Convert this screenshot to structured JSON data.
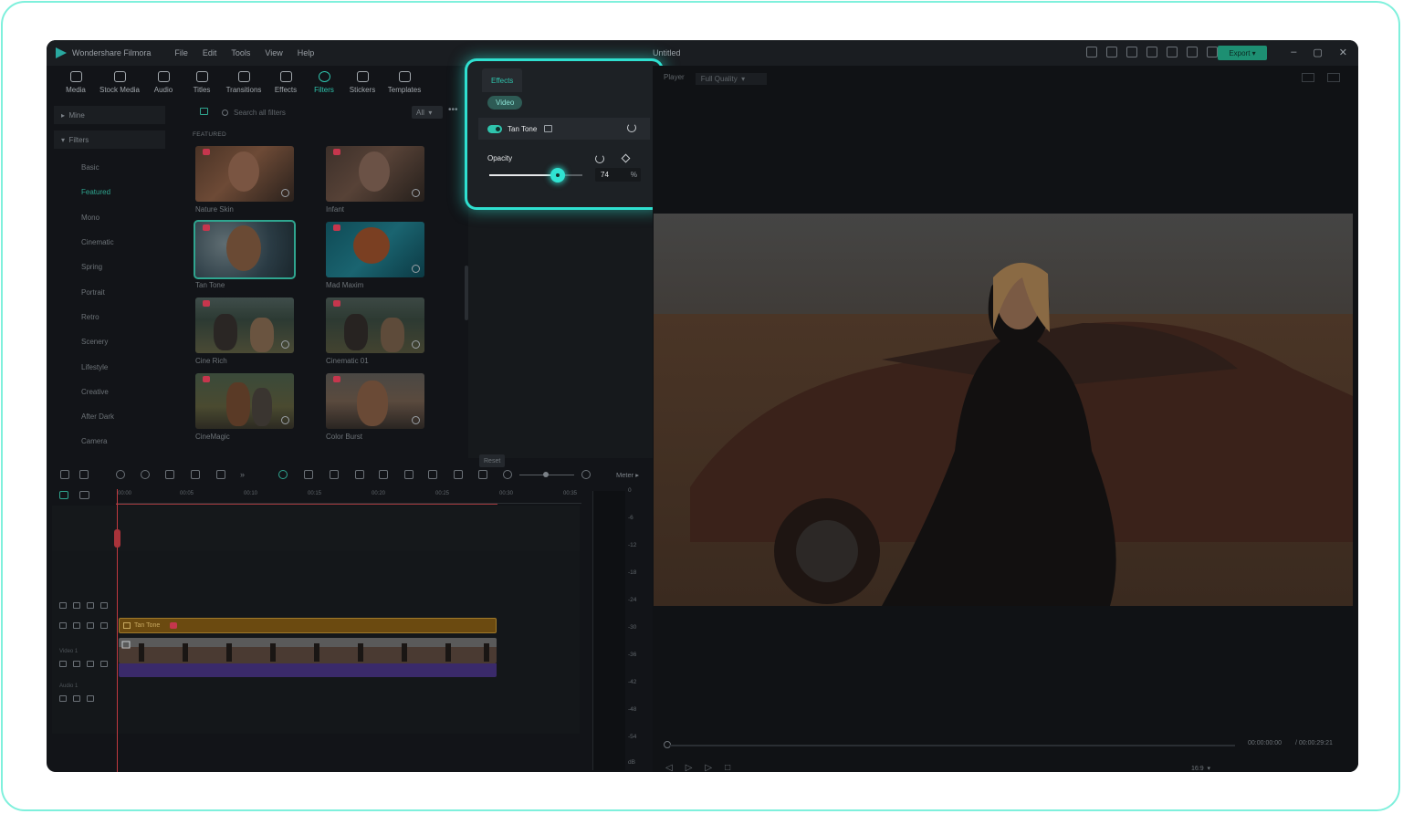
{
  "app": {
    "name": "Wondershare Filmora",
    "doc_title": "Untitled",
    "menu": [
      "File",
      "Edit",
      "Tools",
      "View",
      "Help"
    ],
    "export_label": "Export",
    "accent_color": "#2fc4ad",
    "highlight_color": "#2fe0d0"
  },
  "toolbar": {
    "items": [
      {
        "label": "Media",
        "icon": "media-icon"
      },
      {
        "label": "Stock Media",
        "icon": "stock-media-icon"
      },
      {
        "label": "Audio",
        "icon": "audio-icon"
      },
      {
        "label": "Titles",
        "icon": "titles-icon"
      },
      {
        "label": "Transitions",
        "icon": "transitions-icon"
      },
      {
        "label": "Effects",
        "icon": "effects-icon"
      },
      {
        "label": "Filters",
        "icon": "filters-icon",
        "active": true
      },
      {
        "label": "Stickers",
        "icon": "stickers-icon"
      },
      {
        "label": "Templates",
        "icon": "templates-icon"
      }
    ]
  },
  "categories": {
    "mine": "Mine",
    "filters": "Filters",
    "items": [
      "Basic",
      "Featured",
      "Mono",
      "Cinematic",
      "Spring",
      "Portrait",
      "Retro",
      "Scenery",
      "Lifestyle",
      "Creative",
      "After Dark",
      "Camera"
    ],
    "active": "Featured"
  },
  "filters_grid": {
    "search_placeholder": "Search all filters",
    "filter_select": "All",
    "section_label": "FEATURED",
    "tiles": [
      {
        "label": "Nature Skin"
      },
      {
        "label": "Infant"
      },
      {
        "label": "Tan Tone",
        "selected": true
      },
      {
        "label": "Mad Maxim"
      },
      {
        "label": "Cine Rich"
      },
      {
        "label": "Cinematic 01"
      },
      {
        "label": "CineMagic"
      },
      {
        "label": "Color Burst"
      }
    ]
  },
  "effects_panel": {
    "tab": "Effects",
    "sub_tab": "Video",
    "effect_name": "Tan Tone",
    "enabled": true,
    "opacity_label": "Opacity",
    "opacity_value": "74",
    "opacity_unit": "%",
    "opacity_fraction": 0.74,
    "reset_label": "Reset"
  },
  "player": {
    "label": "Player",
    "quality": "Full Quality",
    "time_current": "00:00:00:00",
    "time_total": "/ 00:00:29:21",
    "ratio": "16:9"
  },
  "timeline": {
    "meter_label": "Meter",
    "ruler": [
      "00:00",
      "00:05",
      "00:10",
      "00:15",
      "00:20",
      "00:25",
      "00:30",
      "00:35"
    ],
    "fx_clip_label": "Tan Tone",
    "video_track_label": "Video 1",
    "audio_track_label": "Audio 1",
    "meter_scale": [
      "0",
      "-6",
      "-12",
      "-18",
      "-24",
      "-30",
      "-36",
      "-42",
      "-48",
      "-54",
      "dB"
    ]
  }
}
